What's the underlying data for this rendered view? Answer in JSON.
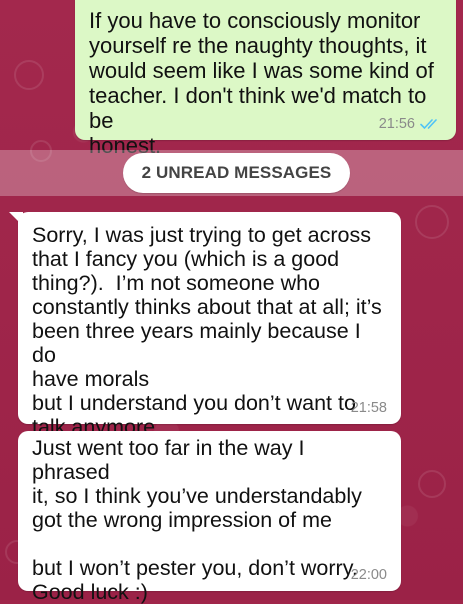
{
  "chat": {
    "messages": [
      {
        "direction": "outgoing",
        "text": "If you have to consciously monitor\nyourself re the naughty thoughts, it\nwould seem like I was some kind of\nteacher. I don't think we'd match to be\nhonest.",
        "time": "21:56",
        "status_icon": "double-check-read-icon"
      },
      {
        "direction": "incoming",
        "text": "Sorry, I was just trying to get across\nthat I fancy you (which is a good\nthing?).  I’m not someone who\nconstantly thinks about that at all; it’s\nbeen three years mainly because I do\nhave morals\nbut I understand you don’t want to\ntalk anymore",
        "time": "21:58"
      },
      {
        "direction": "incoming",
        "text": "Just went too far in the way I phrased\nit, so I think you’ve understandably\ngot the wrong impression of me\n\nbut I won’t pester you, don’t worry.\nGood luck :)",
        "time": "22:00"
      }
    ],
    "unread_banner": "2 UNREAD MESSAGES"
  },
  "colors": {
    "wallpaper": "#a0264a",
    "outgoing_bubble": "#dcf8c6",
    "incoming_bubble": "#ffffff",
    "read_ticks": "#4fc3f7",
    "timestamp": "#8a8a8a"
  }
}
